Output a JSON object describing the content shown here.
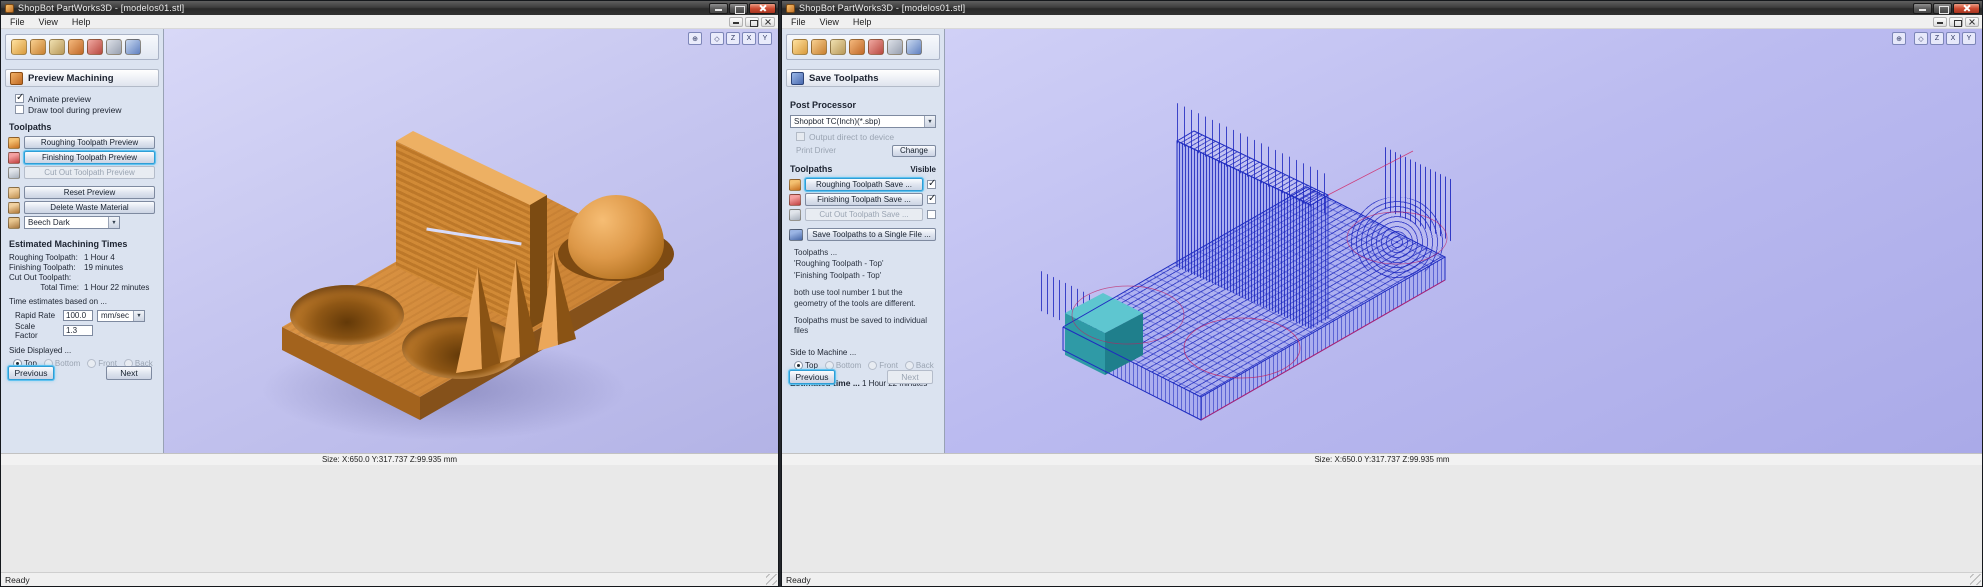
{
  "app": {
    "title": "ShopBot PartWorks3D - [modelos01.stl]",
    "menu": {
      "file": "File",
      "view": "View",
      "help": "Help"
    }
  },
  "statusbar": {
    "size": "Size: X:650.0 Y:317.737 Z:99.935 mm",
    "ready": "Ready"
  },
  "view_toolbar": {
    "icons": [
      {
        "name": "zoom-extents",
        "glyph": "⊕"
      },
      {
        "name": "isometric-view",
        "glyph": "◇"
      },
      {
        "name": "top-view",
        "glyph": "Z"
      },
      {
        "name": "front-view",
        "glyph": "X"
      },
      {
        "name": "side-view",
        "glyph": "Y"
      }
    ]
  },
  "wizard_toolbar": {
    "icons": [
      "load-model",
      "orient-model",
      "material-setup",
      "roughing-toolpath",
      "finishing-toolpath",
      "cutout-toolpath",
      "preview-machining"
    ]
  },
  "preview_panel": {
    "header": "Preview Machining",
    "animate_preview": {
      "label": "Animate preview",
      "checked": true
    },
    "draw_tool": {
      "label": "Draw tool during preview",
      "checked": false
    },
    "toolpaths_label": "Toolpaths",
    "buttons": {
      "roughing": "Roughing Toolpath Preview",
      "finishing": "Finishing Toolpath Preview",
      "cutout": "Cut Out Toolpath Preview",
      "reset": "Reset Preview",
      "delete_waste": "Delete Waste Material"
    },
    "material": "Beech Dark",
    "times_header": "Estimated Machining Times",
    "times": [
      {
        "label": "Roughing Toolpath:",
        "value": "1 Hour 4"
      },
      {
        "label": "Finishing Toolpath:",
        "value": "19 minutes"
      },
      {
        "label": "Cut Out Toolpath:",
        "value": ""
      },
      {
        "label": "Total Time:",
        "value": "1 Hour 22 minutes"
      }
    ],
    "estimates_note": "Time estimates based on ...",
    "rapid_rate": {
      "label": "Rapid Rate",
      "value": "100.0",
      "unit": "mm/sec"
    },
    "scale_factor": {
      "label": "Scale Factor",
      "value": "1.3"
    },
    "side": {
      "label": "Side Displayed ...",
      "options": [
        "Top",
        "Bottom",
        "Front",
        "Back"
      ],
      "selected": "Top"
    },
    "nav": {
      "previous": "Previous",
      "next": "Next"
    }
  },
  "save_panel": {
    "header": "Save Toolpaths",
    "post_processor_label": "Post Processor",
    "post_processor": "Shopbot TC(Inch)(*.sbp)",
    "output_direct": {
      "label": "Output direct to device",
      "checked": false,
      "enabled": false
    },
    "print_driver_label": "Print Driver",
    "change_button": "Change",
    "toolpaths_label": "Toolpaths",
    "visible_label": "Visible",
    "buttons": {
      "roughing": {
        "label": "Roughing Toolpath Save ...",
        "visible_checked": true
      },
      "finishing": {
        "label": "Finishing Toolpath Save ...",
        "visible_checked": true
      },
      "cutout": {
        "label": "Cut Out Toolpath Save ...",
        "visible_checked": false
      },
      "single_file": "Save Toolpaths to a Single File ..."
    },
    "info_lines": [
      "Toolpaths ...",
      "'Roughing Toolpath - Top'",
      "'Finishing Toolpath - Top'",
      "both use  tool number 1 but the geometry of the tools are different.",
      "Toolpaths must be saved to individual files"
    ],
    "side": {
      "label": "Side to Machine ...",
      "options": [
        "Top",
        "Bottom",
        "Front",
        "Back"
      ],
      "selected": "Top"
    },
    "estimated_time": {
      "label": "Estimated time ...",
      "value": "1 Hour 22 minutes"
    },
    "nav": {
      "previous": "Previous",
      "next": "Next"
    }
  },
  "colors": {
    "wood": "#cd8433",
    "viewport_lavender": "#c2c2ee",
    "wireframe_blue": "#1f2cc0",
    "uncut_teal": "#2f9aa6",
    "focus_ring": "#35a8dc"
  }
}
